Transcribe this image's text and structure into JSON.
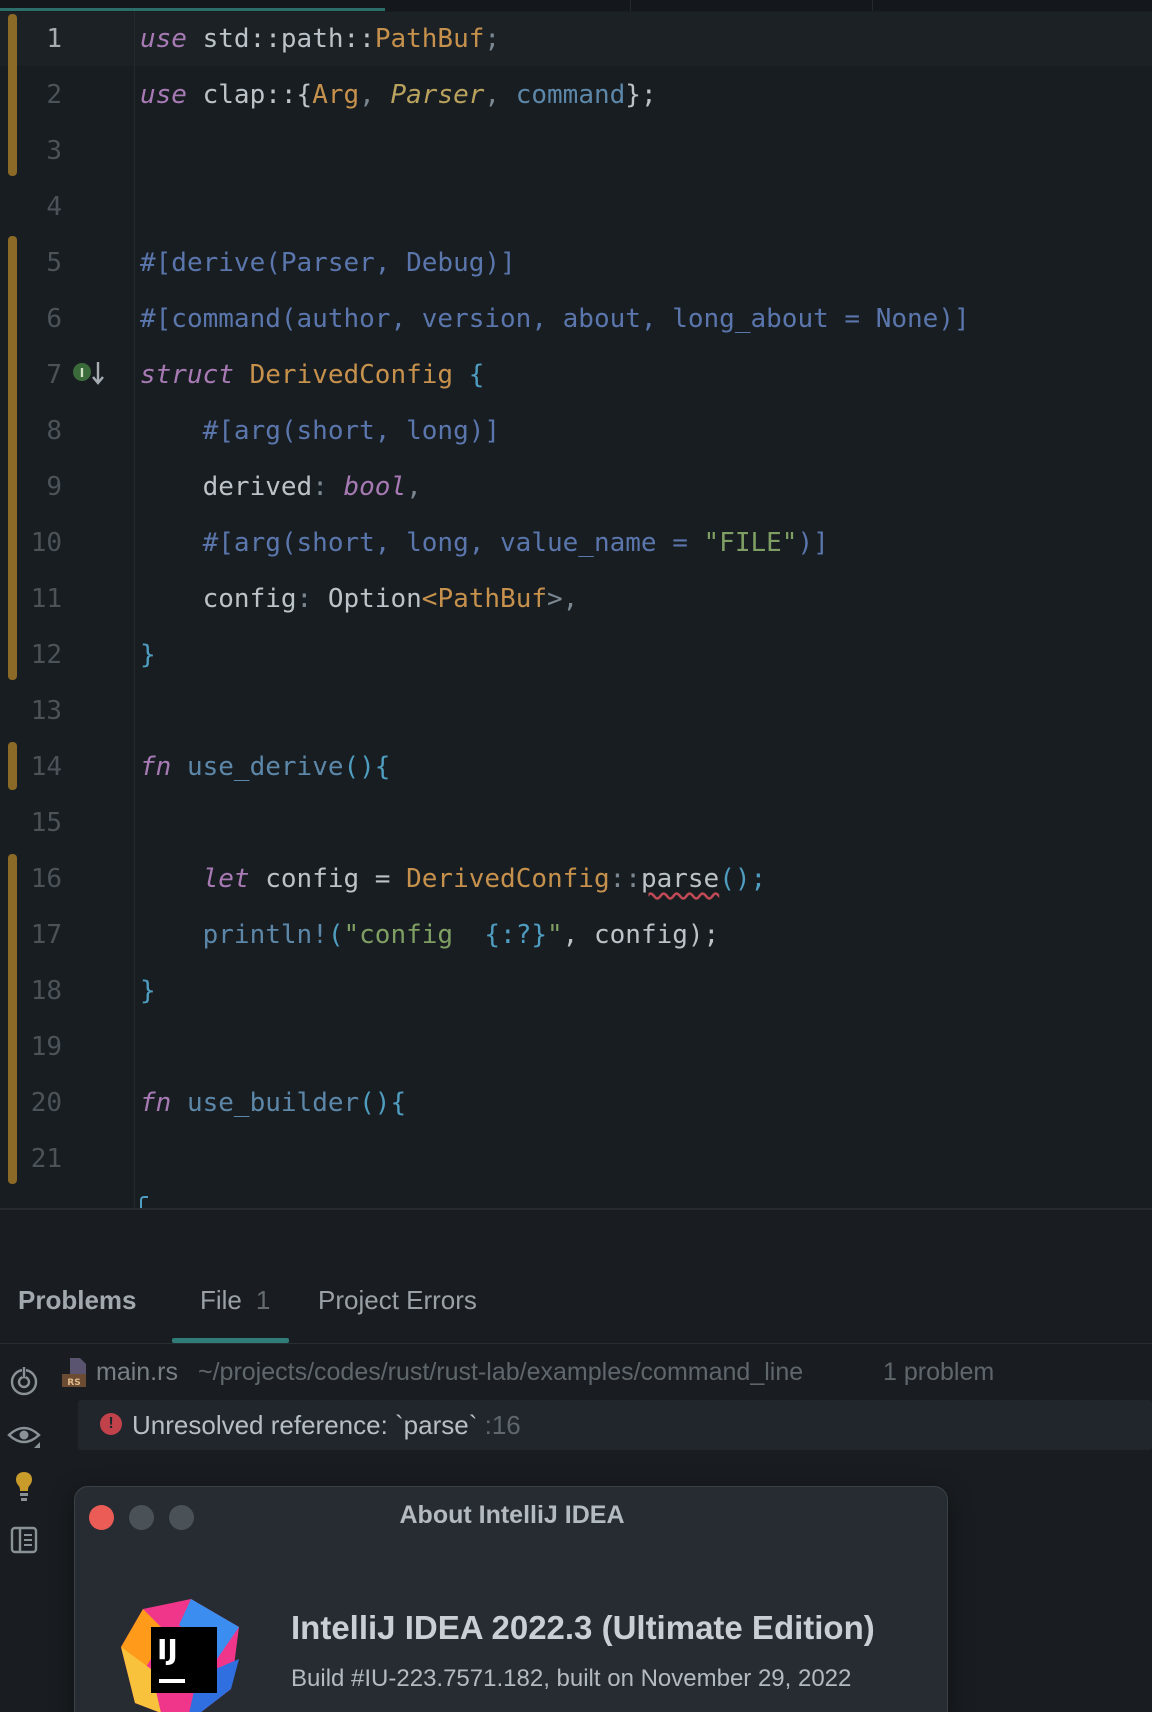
{
  "editor": {
    "active_line": 1,
    "line_numbers": [
      "1",
      "2",
      "3",
      "4",
      "5",
      "6",
      "7",
      "8",
      "9",
      "10",
      "11",
      "12",
      "13",
      "14",
      "15",
      "16",
      "17",
      "18",
      "19",
      "20",
      "21"
    ],
    "code": {
      "l1_use": "use",
      "l1_path": " std::path::",
      "l1_pathbuf": "PathBuf",
      "l1_end": ";",
      "l2_use": "use",
      "l2_clap": " clap::{",
      "l2_arg": "Arg",
      "l2_c1": ", ",
      "l2_parser": "Parser",
      "l2_c2": ", ",
      "l2_command": "command",
      "l2_end": "};",
      "l5_attr": "#[derive(Parser, Debug)]",
      "l6_attr": "#[command(author, version, about, long_about = None)]",
      "l7_struct": "struct",
      "l7_name": " DerivedConfig",
      "l7_brace": " {",
      "l8_attr": "    #[arg(short, long)]",
      "l9_field": "    derived",
      "l9_colon": ": ",
      "l9_type": "bool",
      "l9_comma": ",",
      "l10_attr": "    #[arg(short, long, value_name = ",
      "l10_str": "\"FILE\"",
      "l10_end": ")]",
      "l11_field": "    config",
      "l11_colon": ": ",
      "l11_option": "Option",
      "l11_lt": "<",
      "l11_pathbuf": "PathBuf",
      "l11_gt": ">,",
      "l12_brace": "}",
      "l14_fn": "fn",
      "l14_name": " use_derive",
      "l14_end": "(){",
      "l16_let": "    let",
      "l16_var": " config = ",
      "l16_type": "DerivedConfig",
      "l16_sep": "::",
      "l16_parse": "parse",
      "l16_end": "();",
      "l17_macro": "    println!",
      "l17_open": "(",
      "l17_str": "\"config  ",
      "l17_fmt": "{:?}",
      "l17_strend": "\"",
      "l17_end": ", config);",
      "l18_brace": "}",
      "l20_fn": "fn",
      "l20_name": " use_builder",
      "l20_end": "(){"
    }
  },
  "problems": {
    "title": "Problems",
    "tabs": [
      {
        "label": "File",
        "count": "1"
      },
      {
        "label": "Project Errors"
      }
    ],
    "file": {
      "name": "main.rs",
      "path": "~/projects/codes/rust/rust-lab/examples/command_line",
      "count": "1 problem",
      "icon": "rust-file-icon"
    },
    "items": [
      {
        "message": "Unresolved reference: `parse`",
        "line": ":16",
        "severity_icon": "error-icon"
      }
    ]
  },
  "about_dialog": {
    "title": "About IntelliJ IDEA",
    "product": "IntelliJ IDEA 2022.3 (Ultimate Edition)",
    "build": "Build #IU-223.7571.182, built on November 29, 2022",
    "logo_text": "IJ"
  }
}
